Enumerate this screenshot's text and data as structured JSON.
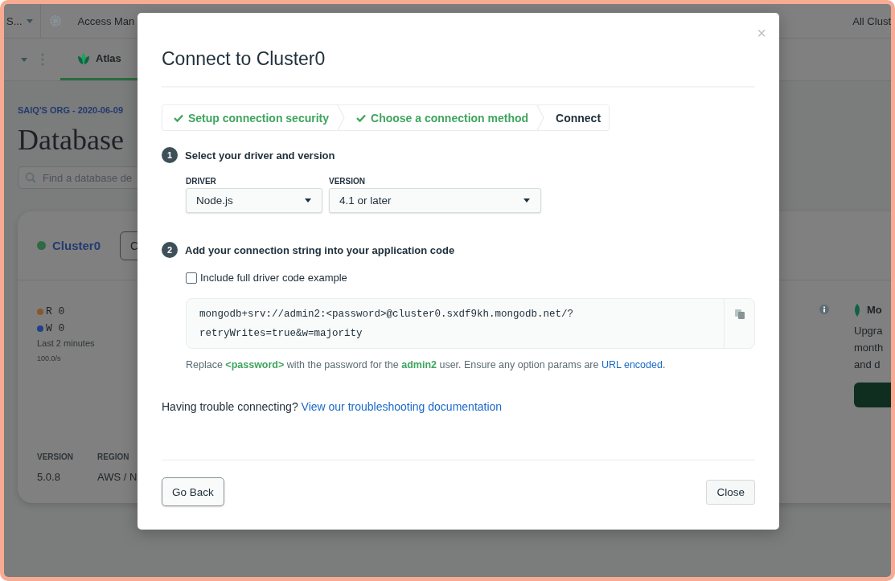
{
  "background": {
    "top_bar": {
      "org_menu": "S...",
      "nav_item": "Access Man",
      "right_menu": "All Clust"
    },
    "tabs": [
      {
        "label": "Atlas",
        "selected": true
      }
    ],
    "breadcrumb": "SAIQ'S ORG - 2020-06-09",
    "page_title": "Database",
    "search": {
      "placeholder": "Find a database de"
    },
    "cluster": {
      "name": "Cluster0",
      "color": "#2e6a45",
      "button": "C",
      "metrics": [
        {
          "label": "R 0",
          "color": "#8a572a"
        },
        {
          "label": "W 0",
          "color": "#22408a"
        }
      ],
      "window": "Last 2 minutes",
      "scale": "100.0/s",
      "details": [
        {
          "label": "VERSION",
          "value": "5.0.8"
        },
        {
          "label": "REGION",
          "value": "AWS / N"
        }
      ]
    },
    "promo": {
      "title": "Mo",
      "lines": [
        "Upgra",
        "month",
        "and d"
      ]
    }
  },
  "modal": {
    "title": "Connect to Cluster0",
    "close": "×",
    "steps": [
      {
        "label": "Setup connection security",
        "completed": true
      },
      {
        "label": "Choose a connection method",
        "completed": true
      },
      {
        "label": "Connect",
        "completed": false
      }
    ],
    "sections": [
      {
        "number": "1",
        "heading": "Select your driver and version"
      },
      {
        "number": "2",
        "heading": "Add your connection string into your application code"
      }
    ],
    "fields": [
      {
        "label": "DRIVER",
        "value": "Node.js"
      },
      {
        "label": "VERSION",
        "value": "4.1 or later"
      }
    ],
    "include_example": {
      "label": "Include full driver code example",
      "checked": false
    },
    "connection_string": [
      "mongodb+srv://admin2:<password>@cluster0.sxdf9kh.mongodb.net/?",
      "retryWrites=true&w=majority"
    ],
    "note": {
      "text": "Replace **<password>** with the password for the **admin2** user. Ensure any option params are ",
      "link": "URL encoded",
      "after": "."
    },
    "help": {
      "text": "Having trouble connecting? ",
      "link": "View our troubleshooting documentation"
    },
    "buttons": [
      {
        "label": "Go Back",
        "kind": "outline"
      },
      {
        "label": "Close",
        "kind": "plain"
      }
    ]
  }
}
